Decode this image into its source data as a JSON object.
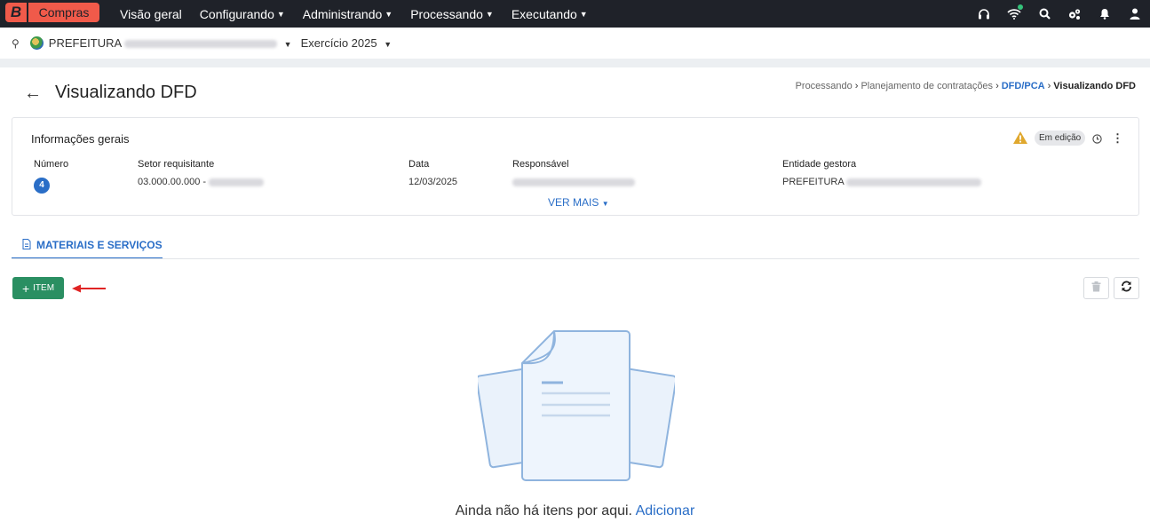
{
  "topnav": {
    "logo_letter": "B",
    "app_name": "Compras",
    "menu": [
      {
        "label": "Visão geral",
        "has_caret": false
      },
      {
        "label": "Configurando",
        "has_caret": true
      },
      {
        "label": "Administrando",
        "has_caret": true
      },
      {
        "label": "Processando",
        "has_caret": true
      },
      {
        "label": "Executando",
        "has_caret": true
      }
    ],
    "icons": [
      "headset-icon",
      "wifi-icon",
      "search-icon",
      "settings-icon",
      "bell-icon",
      "user-icon"
    ]
  },
  "subbar": {
    "entity_prefix": "PREFEITURA",
    "exercise": "Exercício 2025"
  },
  "page": {
    "title": "Visualizando DFD",
    "breadcrumb": [
      "Processando",
      "Planejamento de contratações",
      "DFD/PCA",
      "Visualizando DFD"
    ]
  },
  "info": {
    "title": "Informações gerais",
    "status": "Em edição",
    "fields": {
      "numero_label": "Número",
      "numero_value": "4",
      "setor_label": "Setor requisitante",
      "setor_value": "03.000.00.000 -",
      "data_label": "Data",
      "data_value": "12/03/2025",
      "responsavel_label": "Responsável",
      "entidade_label": "Entidade gestora",
      "entidade_value": "PREFEITURA"
    },
    "ver_mais": "VER MAIS"
  },
  "tabs": [
    {
      "label": "MATERIAIS E SERVIÇOS",
      "active": true
    }
  ],
  "toolbar": {
    "add_item_label": "ITEM"
  },
  "empty_state": {
    "text": "Ainda não há itens por aqui.",
    "link": "Adicionar"
  },
  "colors": {
    "brand": "#f05a4a",
    "nav_bg": "#1f2229",
    "accent": "#2a6ec7",
    "add_button": "#2a8f62",
    "warning": "#e0a82e"
  }
}
